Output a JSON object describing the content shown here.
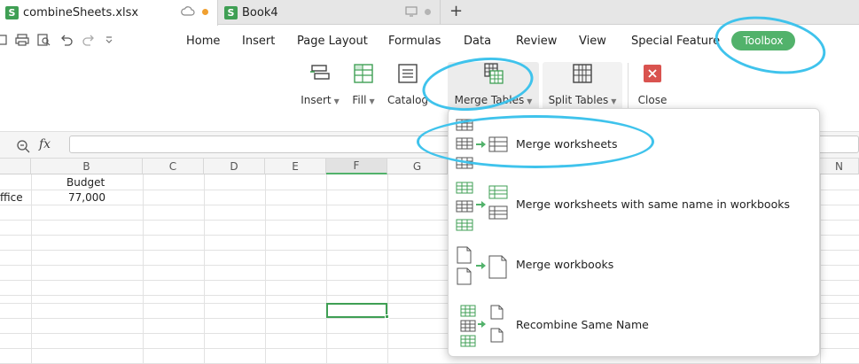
{
  "tabs": [
    {
      "title": "combineSheets.xlsx",
      "active": true
    },
    {
      "title": "Book4",
      "active": false
    }
  ],
  "new_tab_symbol": "+",
  "menu": {
    "items": [
      "Home",
      "Insert",
      "Page Layout",
      "Formulas",
      "Data",
      "Review",
      "View",
      "Special Feature"
    ],
    "active": "Toolbox"
  },
  "ribbon": {
    "insert": "Insert",
    "fill": "Fill",
    "catalog": "Catalog",
    "merge_tables": "Merge Tables",
    "split_tables": "Split Tables",
    "close": "Close"
  },
  "formula_bar": {
    "fx_label": "fx",
    "value": ""
  },
  "columns": [
    "B",
    "C",
    "D",
    "E",
    "F",
    "G",
    "N"
  ],
  "cells": {
    "b1": "Budget",
    "a2_partial": "ffice",
    "b2": "77,000"
  },
  "merge_menu": {
    "items": [
      {
        "label": "Merge worksheets",
        "icon": "merge-worksheets-icon"
      },
      {
        "label": "Merge worksheets with same name in workbooks",
        "icon": "merge-same-name-sheets-icon"
      },
      {
        "label": "Merge workbooks",
        "icon": "merge-workbooks-icon"
      },
      {
        "label": "Recombine Same Name",
        "icon": "recombine-same-name-icon"
      }
    ]
  },
  "colors": {
    "accent_green": "#52b26b",
    "annotation_blue": "#3fc3ec",
    "close_red": "#d9534f"
  }
}
